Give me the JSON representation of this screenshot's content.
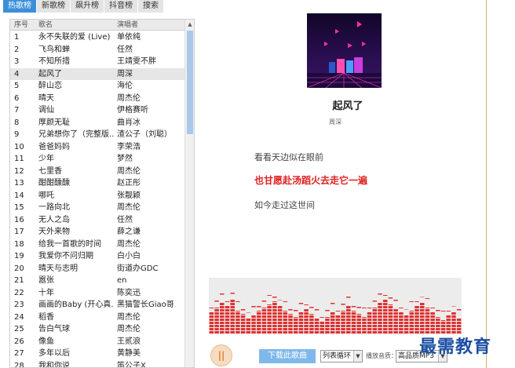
{
  "tabs": [
    "热歌榜",
    "新歌榜",
    "飙升榜",
    "抖音榜",
    "搜索"
  ],
  "active_tab": 0,
  "table": {
    "headers": {
      "num": "序号",
      "title": "歌名",
      "artist": "演唱者"
    },
    "selected_index": 3,
    "rows": [
      [
        "1",
        "永不失联的爱 (Live)",
        "单依纯"
      ],
      [
        "2",
        "飞鸟和蝉",
        "任然"
      ],
      [
        "3",
        "不知所措",
        "王靖雯不胖"
      ],
      [
        "4",
        "起风了",
        "周深"
      ],
      [
        "5",
        "醉山恋",
        "海伦"
      ],
      [
        "6",
        "晴天",
        "周杰伦"
      ],
      [
        "7",
        "调仙",
        "伊格赛听"
      ],
      [
        "8",
        "厚颜无耻",
        "曲肖冰"
      ],
      [
        "9",
        "兄弟想你了（完整版...",
        "渣公子（刘聪）"
      ],
      [
        "10",
        "爸爸妈妈",
        "李荣浩"
      ],
      [
        "11",
        "少年",
        "梦然"
      ],
      [
        "12",
        "七里香",
        "周杰伦"
      ],
      [
        "13",
        "酣酣醺醺",
        "赵正彤"
      ],
      [
        "14",
        "哪吒",
        "张靓颖"
      ],
      [
        "15",
        "一路向北",
        "周杰伦"
      ],
      [
        "16",
        "无人之岛",
        "任然"
      ],
      [
        "17",
        "天外来物",
        "薛之谦"
      ],
      [
        "18",
        "给我一首歌的时间",
        "周杰伦"
      ],
      [
        "19",
        "我爱你不问归期",
        "白小白"
      ],
      [
        "20",
        "晴天与志明",
        "街道办GDC"
      ],
      [
        "21",
        "嚣张",
        "en"
      ],
      [
        "22",
        "十年",
        "陈奕迅"
      ],
      [
        "23",
        "画画的Baby (开心真...",
        "黑猫警长Giao哥"
      ],
      [
        "24",
        "稻香",
        "周杰伦"
      ],
      [
        "25",
        "告白气球",
        "周杰伦"
      ],
      [
        "26",
        "像鱼",
        "王贰浪"
      ],
      [
        "27",
        "多年以后",
        "黄静美"
      ],
      [
        "28",
        "我和你说",
        "笛公子X"
      ]
    ]
  },
  "player": {
    "title": "起风了",
    "artist": "周深",
    "lyrics": [
      "看看天边似在眼前",
      "也甘愿赴汤蹈火去走它一遍",
      "如今走过这世间"
    ],
    "current_lyric": 1,
    "pause_symbol": "||",
    "download_label": "下载此歌曲",
    "play_mode": "列表循环",
    "quality_label": "播放音质：",
    "quality_value": "高品质MP3"
  },
  "icons": {
    "pause": "pause-icon",
    "dropdown": "chevron-down-icon"
  },
  "colors": {
    "accent": "#3b8fd8",
    "lyric_current": "#e02020",
    "visualizer": "#e03030",
    "pause_button": "#e07a24"
  },
  "watermark": "最需教育"
}
